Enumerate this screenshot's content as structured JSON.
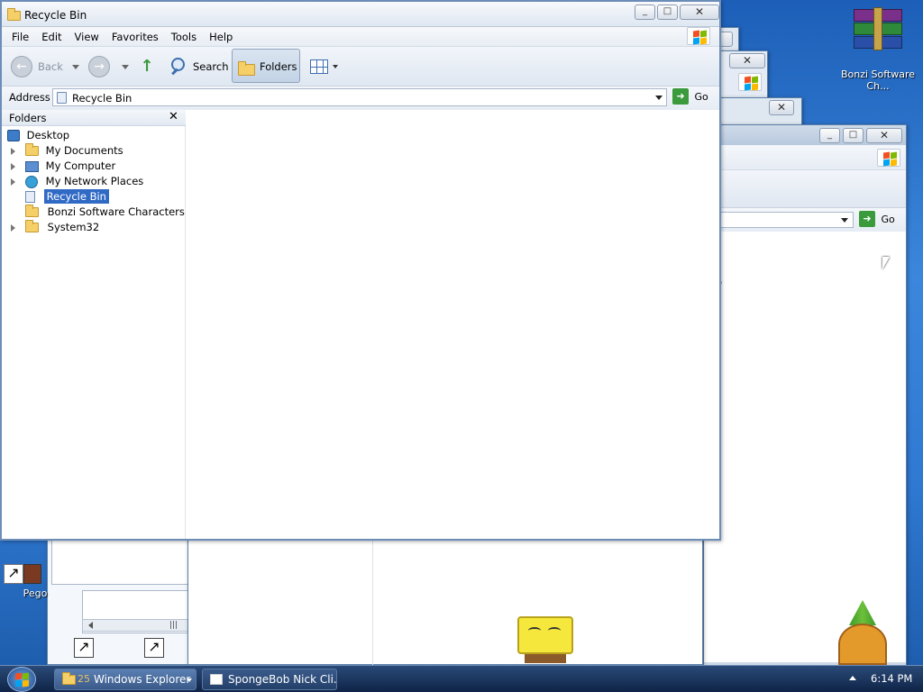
{
  "window": {
    "title": "Recycle Bin",
    "menu": [
      "File",
      "Edit",
      "View",
      "Favorites",
      "Tools",
      "Help"
    ],
    "toolbar": {
      "back_label": "Back",
      "search_label": "Search",
      "folders_label": "Folders"
    },
    "address": {
      "label": "Address",
      "value": "Recycle Bin",
      "go_label": "Go"
    },
    "folders_pane": {
      "title": "Folders",
      "items": [
        {
          "label": "Desktop"
        },
        {
          "label": "My Documents"
        },
        {
          "label": "My Computer"
        },
        {
          "label": "My Network Places"
        },
        {
          "label": "Recycle Bin"
        },
        {
          "label": "Bonzi Software Characters"
        },
        {
          "label": "System32"
        }
      ]
    }
  },
  "background_window": {
    "go_label": "Go",
    "text_fragment": ")"
  },
  "desktop": {
    "icons": [
      {
        "label": "Bonzi Software Ch...",
        "icon": "winrar-icon"
      },
      {
        "label": "Pego",
        "icon": "shortcut-icon"
      }
    ]
  },
  "taskbar": {
    "buttons": [
      {
        "label": "Windows Explorer",
        "count": "25"
      },
      {
        "label": "SpongeBob Nick Cli..."
      }
    ],
    "clock": "6:14 PM"
  },
  "colors": {
    "accent": "#316ac5",
    "taskbar": "#1a3660",
    "selection": "#316ac5"
  }
}
